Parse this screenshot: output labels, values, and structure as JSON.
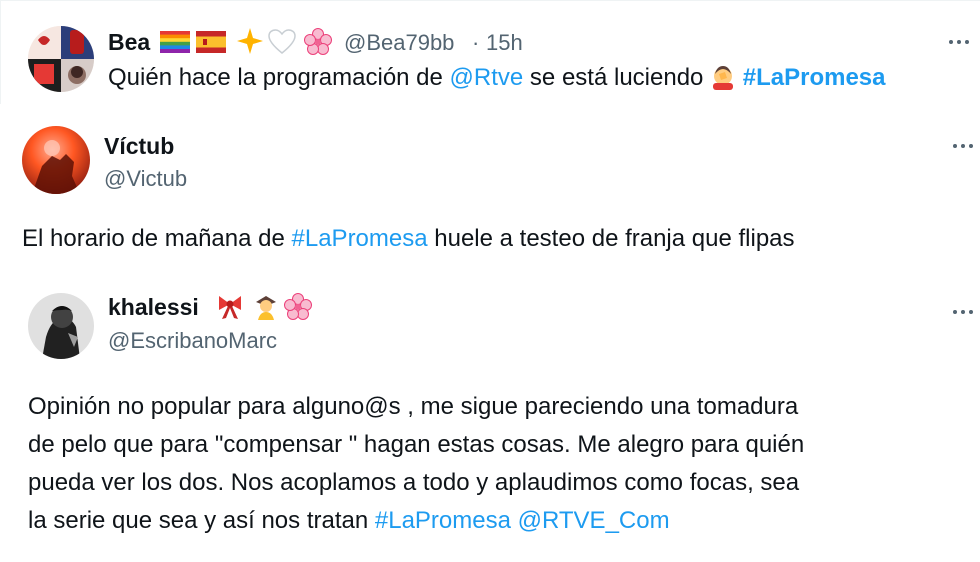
{
  "tweets": [
    {
      "display_name": "Bea",
      "handle": "@Bea79bb",
      "time": "15h",
      "separator": "·",
      "text_before": "Quién hace la programación de ",
      "mention": "@Rtve",
      "text_middle": " se está luciendo ",
      "hashtag": "#LaPromesa"
    },
    {
      "display_name": "Víctub",
      "handle": "@Victub",
      "text_before": "El horario de mañana de ",
      "hashtag": "#LaPromesa",
      "text_after": " huele a testeo de franja que flipas"
    },
    {
      "display_name": "khalessi",
      "handle": "@EscribanoMarc",
      "lines": [
        "Opinión no popular para alguno@s , me sigue pareciendo una tomadura",
        "de pelo que para \"compensar \" hagan estas cosas. Me alegro para quién",
        "pueda ver los dos. Nos acoplamos a todo y aplaudimos como focas, sea",
        "la serie que sea y así nos tratan "
      ],
      "hashtag": "#LaPromesa",
      "mention": "@RTVE_Com"
    }
  ],
  "colors": {
    "text": "#0f1419",
    "secondary": "#536471",
    "accent": "#1d9bf0"
  },
  "icons": [
    "more-options-icon",
    "rainbow-flag-icon",
    "spain-flag-icon",
    "sparkle-star-icon",
    "white-heart-icon",
    "cherry-blossom-icon",
    "facepalm-icon",
    "ribbon-icon",
    "teacher-icon"
  ]
}
